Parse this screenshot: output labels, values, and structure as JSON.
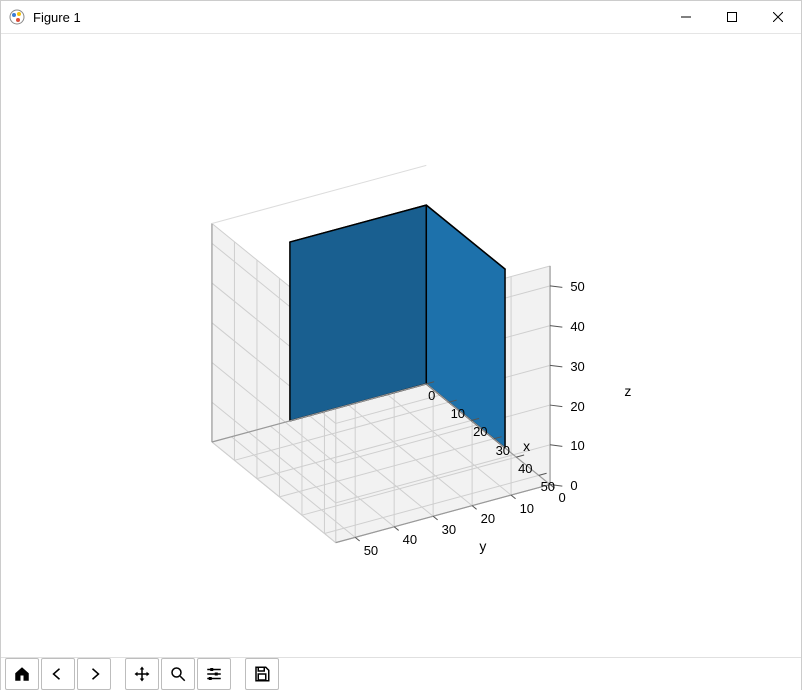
{
  "window": {
    "title": "Figure 1",
    "buttons": {
      "minimize": "minimize",
      "maximize": "maximize",
      "close": "close"
    }
  },
  "toolbar": {
    "home": "Home",
    "back": "Back",
    "forward": "Forward",
    "pan": "Pan",
    "zoom": "Zoom",
    "subplots": "Configure subplots",
    "save": "Save"
  },
  "chart_data": {
    "type": "3d-surface",
    "description": "Solid blue axis-aligned cuboid (voxel) in a 3-D axes box",
    "xlabel": "x",
    "ylabel": "y",
    "zlabel": "z",
    "x_ticks": [
      0,
      10,
      20,
      30,
      40,
      50
    ],
    "y_ticks": [
      0,
      10,
      20,
      30,
      40,
      50
    ],
    "z_ticks": [
      0,
      10,
      20,
      30,
      40,
      50
    ],
    "xlim": [
      0,
      55
    ],
    "ylim": [
      0,
      55
    ],
    "zlim": [
      0,
      55
    ],
    "cuboid": {
      "x": [
        0,
        35
      ],
      "y": [
        0,
        35
      ],
      "z": [
        0,
        45
      ]
    },
    "face_color": "#1f77b4",
    "edge_color": "#000000",
    "grid": true,
    "pane_color": "#f2f2f2"
  }
}
